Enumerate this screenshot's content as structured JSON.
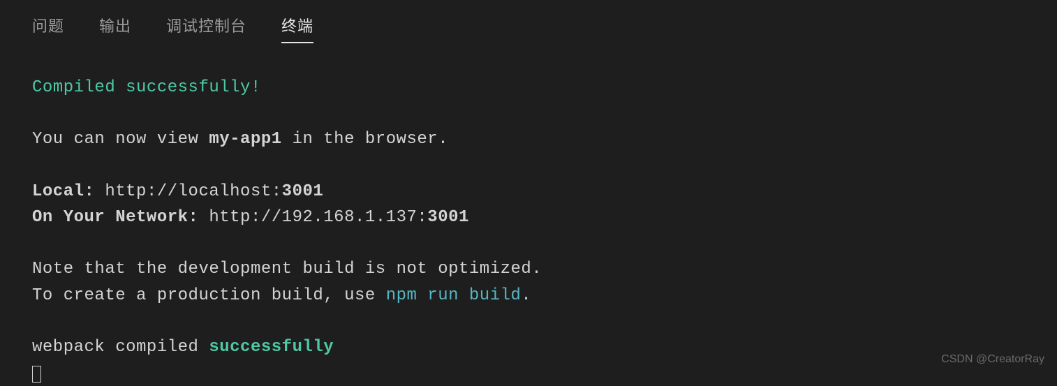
{
  "tabs": {
    "problems": "问题",
    "output": "输出",
    "debug_console": "调试控制台",
    "terminal": "终端"
  },
  "terminal": {
    "compiled_msg": "Compiled successfully!",
    "view_prefix": "You can now view ",
    "app_name": "my-app1",
    "view_suffix": " in the browser.",
    "local_label": "Local:",
    "local_url_prefix": "http://localhost:",
    "local_port": "3001",
    "network_label": "On Your Network:",
    "network_url_prefix": "http://192.168.1.137:",
    "network_port": "3001",
    "note_line1": "Note that the development build is not optimized.",
    "note_line2_prefix": "To create a production build, use ",
    "build_cmd": "npm run build",
    "note_line2_suffix": ".",
    "webpack_prefix": "webpack compiled ",
    "webpack_status": "successfully"
  },
  "watermark": "CSDN @CreatorRay"
}
